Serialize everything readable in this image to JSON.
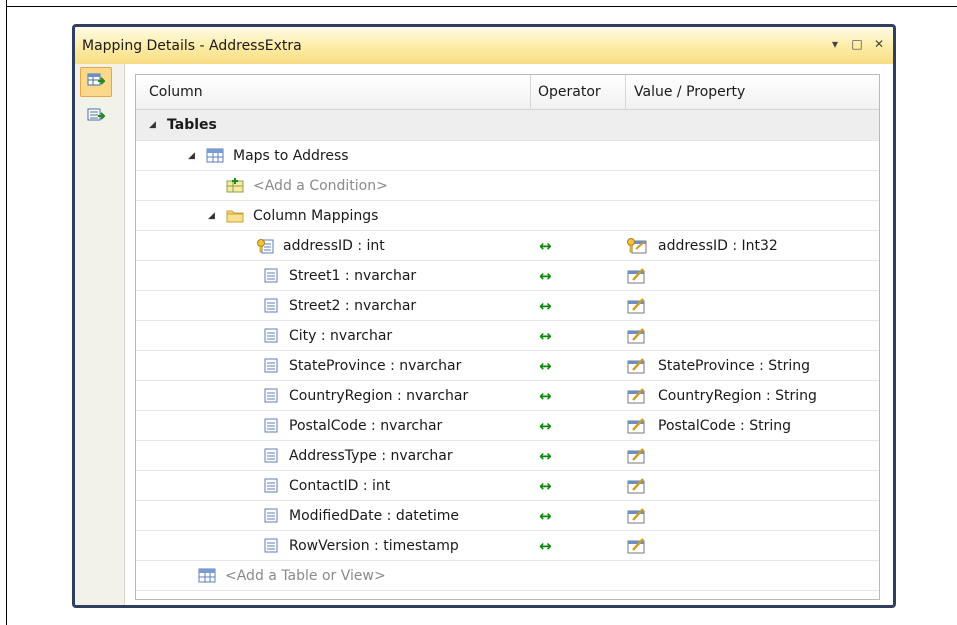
{
  "window": {
    "title": "Mapping Details - AddressExtra",
    "buttons": {
      "dropdown": "▾",
      "maximize": "□",
      "close": "✕"
    }
  },
  "sidebar": {
    "buttons": [
      {
        "icon": "map-entity-to-tables-icon",
        "active": true
      },
      {
        "icon": "map-entity-to-functions-icon",
        "active": false
      }
    ]
  },
  "grid": {
    "headers": {
      "column": "Column",
      "operator": "Operator",
      "value": "Value / Property"
    },
    "tables_label": "Tables",
    "maps_to_label": "Maps to Address",
    "add_condition": "<Add a Condition>",
    "column_mappings_label": "Column Mappings",
    "mappings": [
      {
        "column": "addressID : int",
        "operator": "↔",
        "property": "addressID : Int32",
        "key": true
      },
      {
        "column": "Street1 : nvarchar",
        "operator": "↔",
        "property": "",
        "key": false
      },
      {
        "column": "Street2 : nvarchar",
        "operator": "↔",
        "property": "",
        "key": false
      },
      {
        "column": "City : nvarchar",
        "operator": "↔",
        "property": "",
        "key": false
      },
      {
        "column": "StateProvince : nvarchar",
        "operator": "↔",
        "property": "StateProvince : String",
        "key": false
      },
      {
        "column": "CountryRegion : nvarchar",
        "operator": "↔",
        "property": "CountryRegion : String",
        "key": false
      },
      {
        "column": "PostalCode : nvarchar",
        "operator": "↔",
        "property": "PostalCode : String",
        "key": false
      },
      {
        "column": "AddressType : nvarchar",
        "operator": "↔",
        "property": "",
        "key": false
      },
      {
        "column": "ContactID : int",
        "operator": "↔",
        "property": "",
        "key": false
      },
      {
        "column": "ModifiedDate : datetime",
        "operator": "↔",
        "property": "",
        "key": false
      },
      {
        "column": "RowVersion : timestamp",
        "operator": "↔",
        "property": "",
        "key": false
      }
    ],
    "add_table": "<Add a Table or View>"
  },
  "colors": {
    "titlebar": "#fdeca4",
    "frame": "#2f3f5d",
    "arrow": "#0a8a0a",
    "active_button": "#fcd88b"
  }
}
